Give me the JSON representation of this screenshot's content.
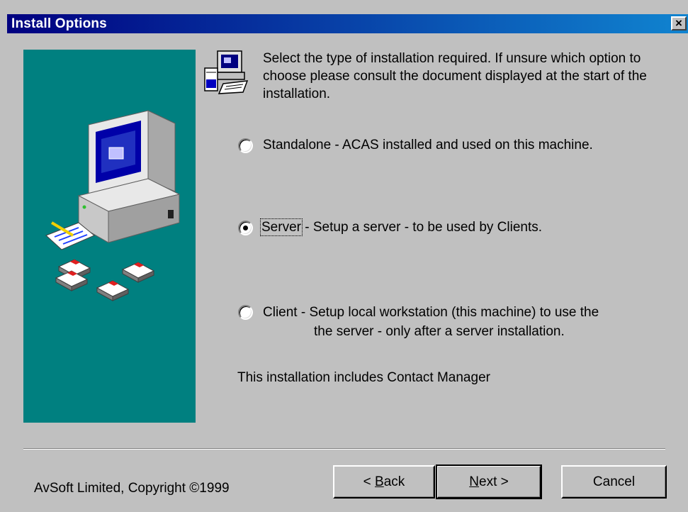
{
  "window": {
    "title": "Install Options",
    "close_label": "×"
  },
  "intro": {
    "text": "Select the type of installation required.  If unsure which option to choose please consult the document displayed at the start of the installation."
  },
  "options": [
    {
      "label": "Standalone - ACAS installed and used on this machine.",
      "selected": false
    },
    {
      "label_main": "Server",
      "label_rest": " - Setup a server - to be used by Clients.",
      "selected": true
    },
    {
      "label_line1": "Client - Setup local workstation (this machine) to use the",
      "label_line2": "the server - only after a server installation.",
      "selected": false
    }
  ],
  "note": "This installation includes Contact Manager",
  "footer": {
    "copyright": "AvSoft Limited, Copyright ©1999",
    "buttons": {
      "back_prefix": "< ",
      "back_underlined": "B",
      "back_rest": "ack",
      "next_underlined": "N",
      "next_rest": "ext >",
      "cancel": "Cancel"
    }
  },
  "colors": {
    "titlebar_start": "#000080",
    "titlebar_end": "#1084d0",
    "side_panel": "#008080",
    "dialog_bg": "#c0c0c0"
  },
  "icons": {
    "side_panel": "computer-with-floppy-disks-illustration",
    "setup": "setup-installer-icon"
  }
}
